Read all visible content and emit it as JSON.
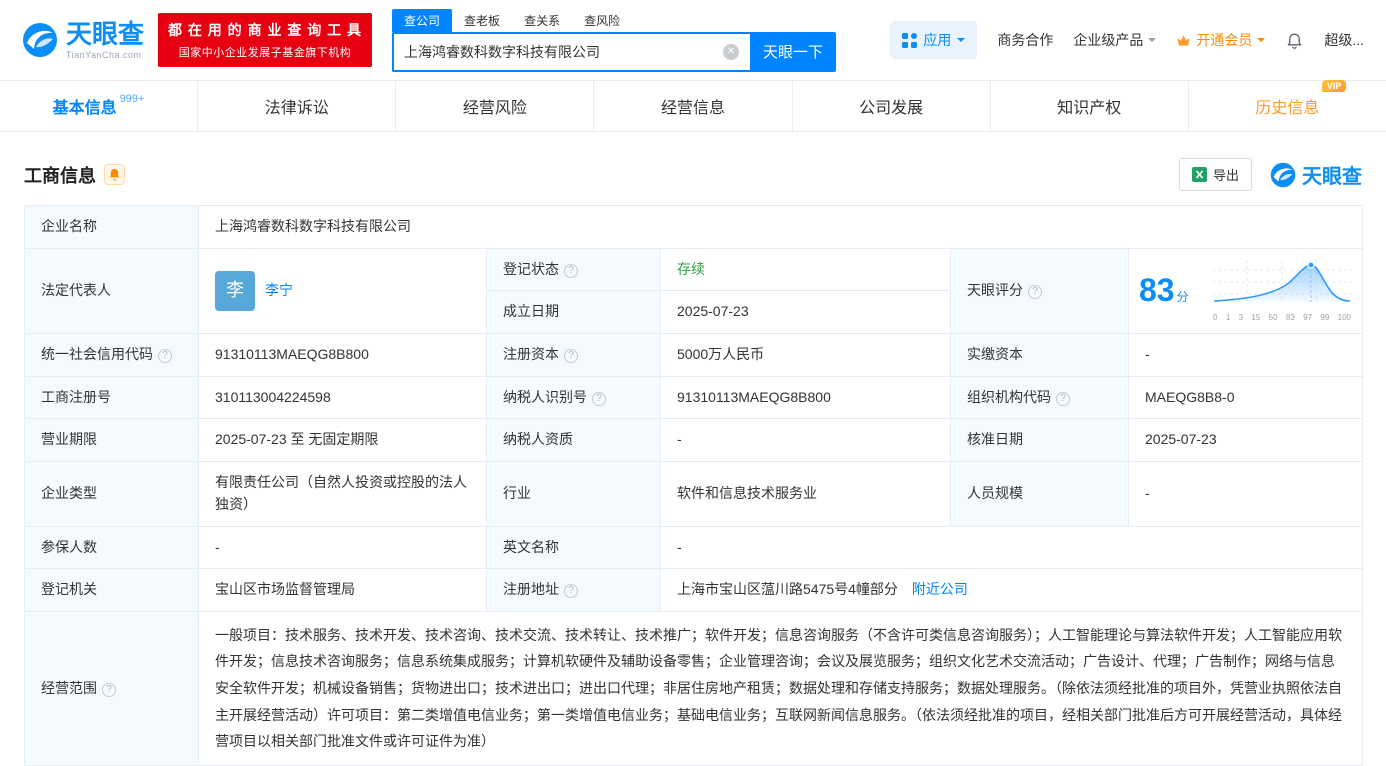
{
  "brand": {
    "name": "天眼查",
    "domain": "TianYanCha.com"
  },
  "promo": {
    "line1": "都 在 用 的 商 业 查 询 工 具",
    "line2": "国家中小企业发展子基金旗下机构"
  },
  "search": {
    "tabs": [
      "查公司",
      "查老板",
      "查关系",
      "查风险"
    ],
    "value": "上海鸿睿数科数字科技有限公司",
    "button": "天眼一下"
  },
  "topnav": {
    "apps": "应用",
    "cooperation": "商务合作",
    "enterprise": "企业级产品",
    "vip": "开通会员",
    "super": "超级..."
  },
  "tabs": {
    "basic": "基本信息",
    "basic_badge": "999+",
    "legal": "法律诉讼",
    "risk": "经营风险",
    "business": "经营信息",
    "development": "公司发展",
    "ip": "知识产权",
    "history": "历史信息",
    "history_vip": "VIP"
  },
  "section": {
    "title": "工商信息",
    "export": "导出"
  },
  "score": {
    "value": "83",
    "unit": "分",
    "axis": [
      "0",
      "1",
      "3",
      "15",
      "50",
      "83",
      "97",
      "99",
      "100"
    ]
  },
  "colors": {
    "primary": "#0084ff",
    "status_green": "#2ba245",
    "vip_orange": "#ff8a00",
    "promo_red": "#e60012"
  },
  "info": {
    "company_name": {
      "label": "企业名称",
      "value": "上海鸿睿数科数字科技有限公司"
    },
    "legal_rep": {
      "label": "法定代表人",
      "avatar": "李",
      "name": "李宁"
    },
    "reg_status": {
      "label": "登记状态",
      "value": "存续"
    },
    "score_label": "天眼评分",
    "establish_date": {
      "label": "成立日期",
      "value": "2025-07-23"
    },
    "credit_code": {
      "label": "统一社会信用代码",
      "value": "91310113MAEQG8B800"
    },
    "reg_capital": {
      "label": "注册资本",
      "value": "5000万人民币"
    },
    "paid_capital": {
      "label": "实缴资本",
      "value": "-"
    },
    "reg_number": {
      "label": "工商注册号",
      "value": "310113004224598"
    },
    "taxpayer_id": {
      "label": "纳税人识别号",
      "value": "91310113MAEQG8B800"
    },
    "org_code": {
      "label": "组织机构代码",
      "value": "MAEQG8B8-0"
    },
    "term": {
      "label": "营业期限",
      "value": "2025-07-23 至 无固定期限"
    },
    "taxpayer_quality": {
      "label": "纳税人资质",
      "value": "-"
    },
    "approval_date": {
      "label": "核准日期",
      "value": "2025-07-23"
    },
    "company_type": {
      "label": "企业类型",
      "value": "有限责任公司（自然人投资或控股的法人独资）"
    },
    "industry": {
      "label": "行业",
      "value": "软件和信息技术服务业"
    },
    "staff": {
      "label": "人员规模",
      "value": "-"
    },
    "insured": {
      "label": "参保人数",
      "value": "-"
    },
    "english_name": {
      "label": "英文名称",
      "value": "-"
    },
    "authority": {
      "label": "登记机关",
      "value": "宝山区市场监督管理局"
    },
    "address": {
      "label": "注册地址",
      "value": "上海市宝山区蕰川路5475号4幢部分",
      "link": "附近公司"
    },
    "scope": {
      "label": "经营范围",
      "value": "一般项目：技术服务、技术开发、技术咨询、技术交流、技术转让、技术推广；软件开发；信息咨询服务（不含许可类信息咨询服务）；人工智能理论与算法软件开发；人工智能应用软件开发；信息技术咨询服务；信息系统集成服务；计算机软硬件及辅助设备零售；企业管理咨询；会议及展览服务；组织文化艺术交流活动；广告设计、代理；广告制作；网络与信息安全软件开发；机械设备销售；货物进出口；技术进出口；进出口代理；非居住房地产租赁；数据处理和存储支持服务；数据处理服务。（除依法须经批准的项目外，凭营业执照依法自主开展经营活动）许可项目：第二类增值电信业务；第一类增值电信业务；基础电信业务；互联网新闻信息服务。（依法须经批准的项目，经相关部门批准后方可开展经营活动，具体经营项目以相关部门批准文件或许可证件为准）"
    }
  }
}
